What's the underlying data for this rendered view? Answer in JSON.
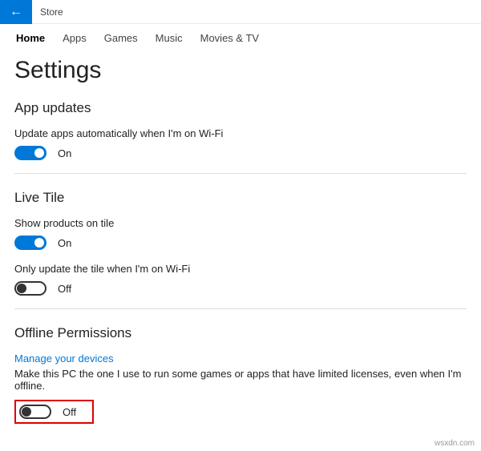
{
  "titlebar": {
    "app_title": "Store"
  },
  "tabs": {
    "items": [
      {
        "label": "Home",
        "active": true
      },
      {
        "label": "Apps",
        "active": false
      },
      {
        "label": "Games",
        "active": false
      },
      {
        "label": "Music",
        "active": false
      },
      {
        "label": "Movies & TV",
        "active": false
      }
    ]
  },
  "page": {
    "title": "Settings"
  },
  "app_updates": {
    "header": "App updates",
    "label": "Update apps automatically when I'm on Wi-Fi",
    "state": "On"
  },
  "live_tile": {
    "header": "Live Tile",
    "show_label": "Show products on tile",
    "show_state": "On",
    "update_label": "Only update the tile when I'm on Wi-Fi",
    "update_state": "Off"
  },
  "offline": {
    "header": "Offline Permissions",
    "link": "Manage your devices",
    "desc": "Make this PC the one I use to run some games or apps that have limited licenses, even when I'm offline.",
    "state": "Off"
  },
  "watermark": "wsxdn.com"
}
